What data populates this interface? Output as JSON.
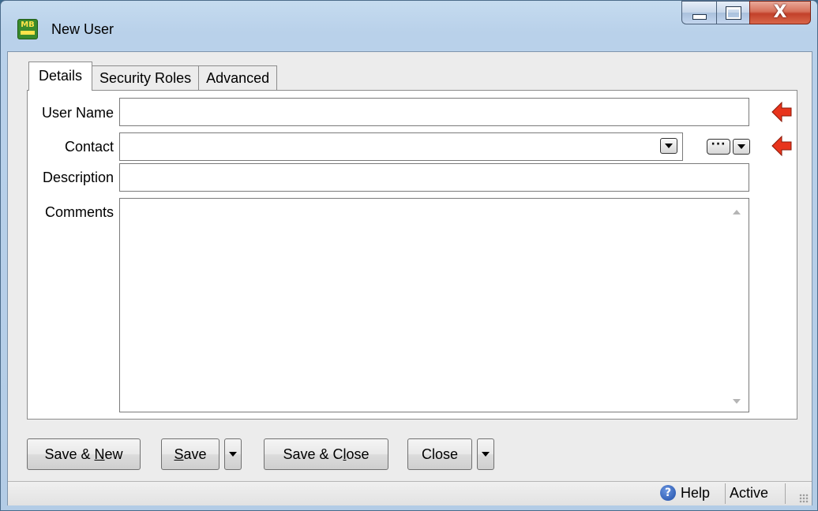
{
  "window": {
    "title": "New User",
    "app_icon_text": "MB",
    "controls": {
      "minimize": "minimize",
      "maximize": "maximize",
      "close": "X"
    }
  },
  "tabs": [
    {
      "label": "Details",
      "active": true
    },
    {
      "label": "Security Roles",
      "active": false
    },
    {
      "label": "Advanced",
      "active": false
    }
  ],
  "form": {
    "user_name": {
      "label": "User Name",
      "value": "",
      "required": true
    },
    "contact": {
      "label": "Contact",
      "value": "",
      "required": true,
      "lookup_label": "···"
    },
    "description": {
      "label": "Description",
      "value": ""
    },
    "comments": {
      "label": "Comments",
      "value": ""
    }
  },
  "buttons": {
    "save_new": {
      "pre": "Save & ",
      "key": "N",
      "post": "ew"
    },
    "save": {
      "pre": "",
      "key": "S",
      "post": "ave"
    },
    "save_close": {
      "pre": "Save & C",
      "key": "l",
      "post": "ose"
    },
    "close": {
      "label": "Close"
    }
  },
  "status": {
    "help": "Help",
    "state": "Active",
    "help_icon_glyph": "?"
  },
  "colors": {
    "required_arrow": "#e8341c",
    "titlebar": "#b9d1ea",
    "close_button": "#c2412a"
  }
}
